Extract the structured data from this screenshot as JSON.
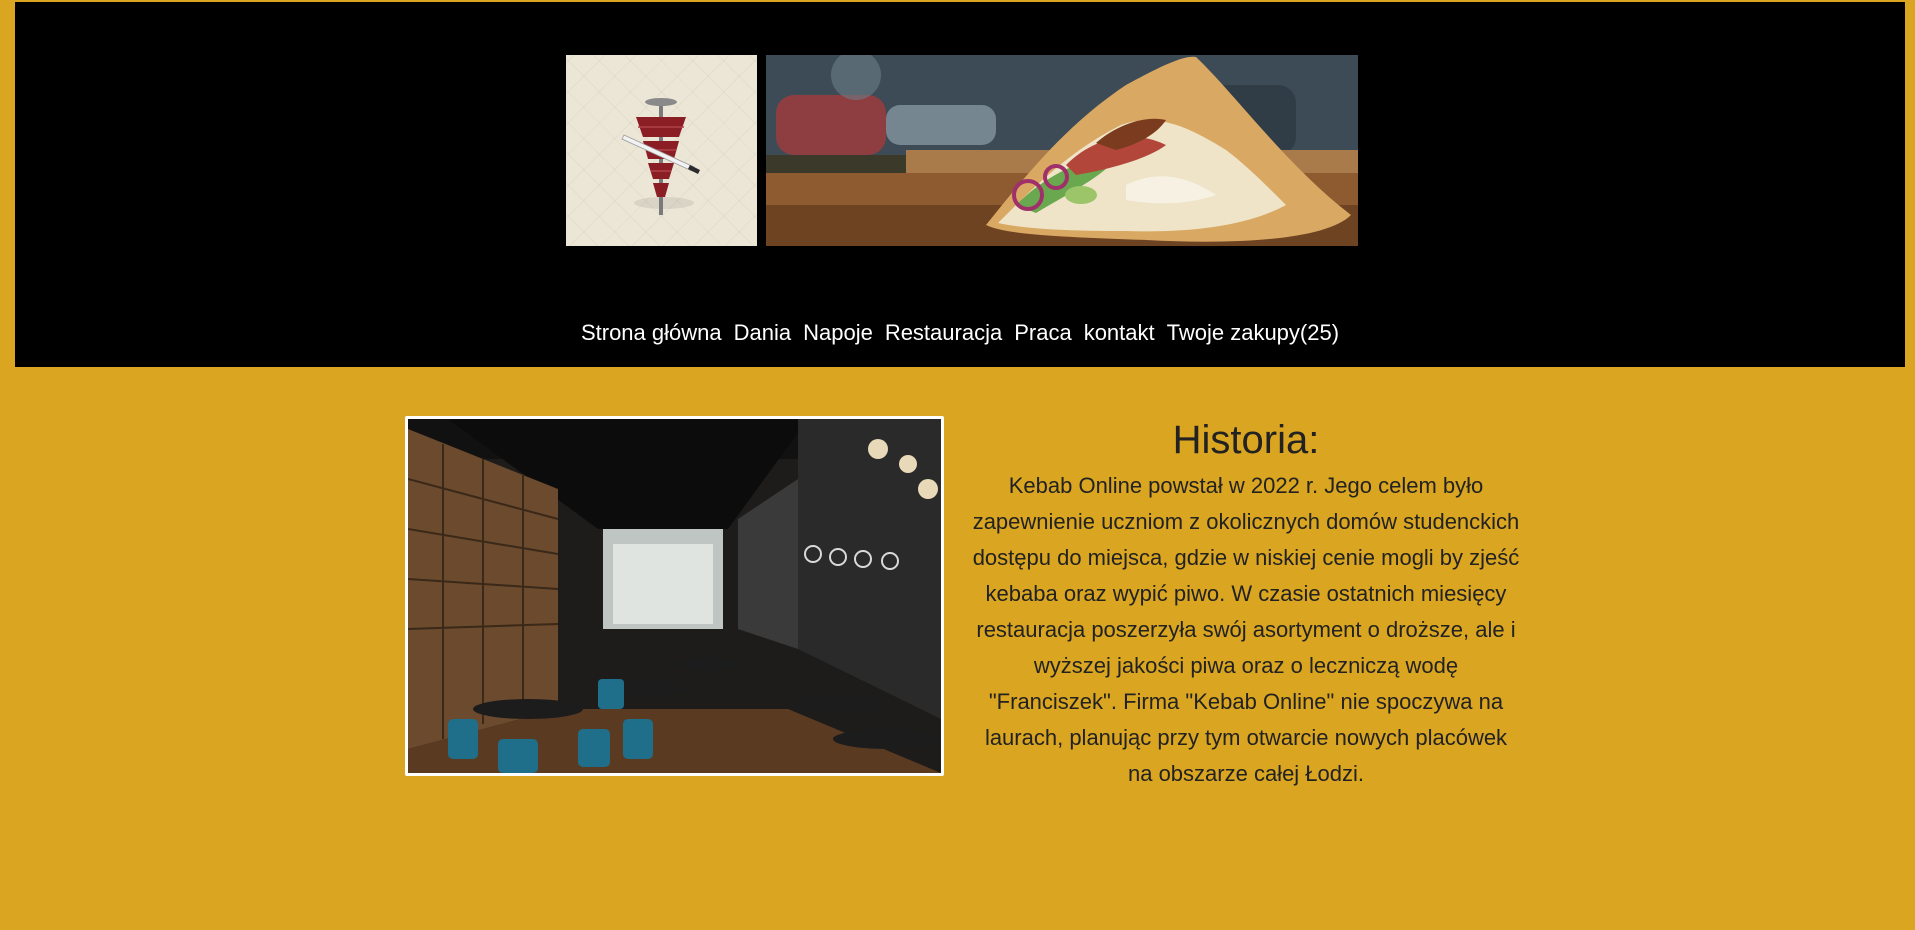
{
  "header": {
    "logo": {
      "icon": "kebab-spit-icon"
    },
    "banner": {
      "icon": "kebab-wrap-photo"
    }
  },
  "nav": {
    "items": [
      {
        "label": "Strona główna"
      },
      {
        "label": "Dania"
      },
      {
        "label": "Napoje"
      },
      {
        "label": "Restauracja"
      },
      {
        "label": "Praca"
      },
      {
        "label": "kontakt"
      },
      {
        "label": "Twoje zakupy(25)"
      }
    ]
  },
  "main": {
    "photo": {
      "icon": "restaurant-interior-photo"
    },
    "history": {
      "title": "Historia:",
      "text": "Kebab Online powstał w 2022 r. Jego celem było zapewnienie uczniom z okolicznych domów studenckich dostępu do miejsca, gdzie w niskiej cenie mogli by zjeść kebaba oraz wypić piwo. W czasie ostatnich miesięcy restauracja poszerzyła swój asortyment o droższe, ale i wyższej jakości piwa oraz o leczniczą wodę \"Franciszek\". Firma \"Kebab Online\" nie spoczywa na laurach, planując przy tym otwarcie nowych placówek na obszarze całej Łodzi."
    }
  },
  "colors": {
    "page_background": "#daa520",
    "header_background": "#000000",
    "nav_text": "#ffffff",
    "body_text": "#222222",
    "photo_border": "#ffffff"
  }
}
